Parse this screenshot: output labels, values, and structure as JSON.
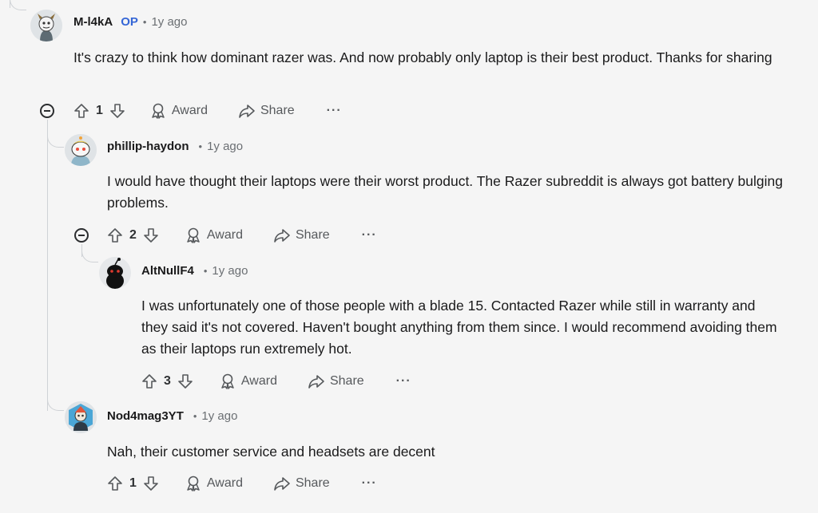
{
  "comments": [
    {
      "username": "M-l4kA",
      "op_badge": "OP",
      "separator": "•",
      "time": "1y ago",
      "text": "It's crazy to think how dominant razer was. And now probably only laptop is their best product. Thanks for sharing",
      "score": "1",
      "award_label": "Award",
      "share_label": "Share",
      "more_label": "···"
    },
    {
      "username": "phillip-haydon",
      "separator": "•",
      "time": "1y ago",
      "text": "I would have thought their laptops were their worst product. The Razer subreddit is always got battery bulging problems.",
      "score": "2",
      "award_label": "Award",
      "share_label": "Share",
      "more_label": "···"
    },
    {
      "username": "AltNullF4",
      "separator": "•",
      "time": "1y ago",
      "text": "I was unfortunately one of those people with a blade 15. Contacted Razer while still in warranty and they said it's not covered. Haven't bought anything from them since. I would recommend avoiding them as their laptops run extremely hot.",
      "score": "3",
      "award_label": "Award",
      "share_label": "Share",
      "more_label": "···"
    },
    {
      "username": "Nod4mag3YT",
      "separator": "•",
      "time": "1y ago",
      "text": "Nah, their customer service and headsets are decent",
      "score": "1",
      "award_label": "Award",
      "share_label": "Share",
      "more_label": "···"
    }
  ],
  "colors": {
    "op": "#3566d6",
    "thread_line": "#cfd2d6",
    "muted": "#6b6f73",
    "background": "#f5f5f5"
  },
  "icons": [
    "upvote-icon",
    "downvote-icon",
    "award-icon",
    "share-icon",
    "collapse-icon",
    "more-icon"
  ]
}
